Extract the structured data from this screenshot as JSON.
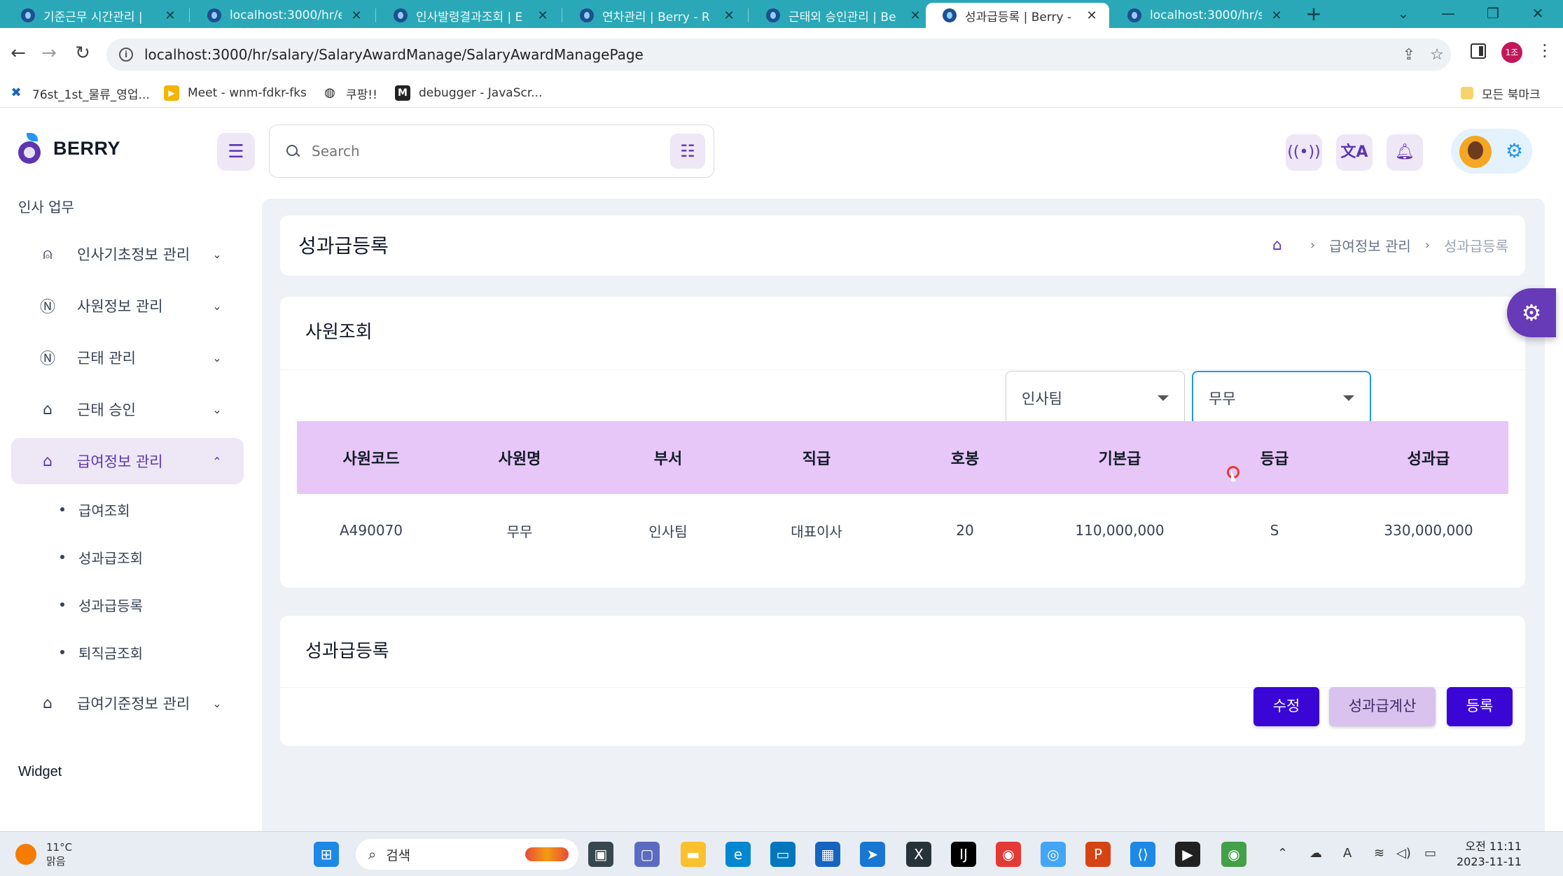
{
  "browser": {
    "tabs": [
      {
        "title": "기준근무 시간관리 |",
        "active": false
      },
      {
        "title": "localhost:3000/hr/en",
        "active": false
      },
      {
        "title": "인사발령결과조회 | E",
        "active": false
      },
      {
        "title": "연차관리 | Berry - R",
        "active": false
      },
      {
        "title": "근태외 승인관리 | Be",
        "active": false
      },
      {
        "title": "성과급등록 | Berry -",
        "active": true
      },
      {
        "title": "localhost:3000/hr/sa",
        "active": false
      }
    ],
    "url": "localhost:3000/hr/salary/SalaryAwardManage/SalaryAwardManagePage",
    "profile_badge": "1조",
    "bookmarks": [
      {
        "label": "76st_1st_물류_영업...",
        "icon": "x-icon",
        "color": "#1565c0"
      },
      {
        "label": "Meet - wnm-fdkr-fks",
        "icon": "meet-icon",
        "color": "#f4b400"
      },
      {
        "label": "쿠팡!!",
        "icon": "globe-icon",
        "color": "#222222"
      },
      {
        "label": "debugger - JavaScr...",
        "icon": "m-icon",
        "color": "#222222"
      }
    ],
    "all_bookmarks": "모든 북마크"
  },
  "app": {
    "logo_text": "BERRY",
    "search": {
      "placeholder": "Search"
    },
    "colors": {
      "primary": "#5e35b1",
      "secondary": "#2196f3",
      "table_header": "#e6c7f7",
      "button_primary": "#3a06d6"
    }
  },
  "sidebar": {
    "heading": "인사 업무",
    "items": [
      {
        "label": "인사기초정보 관리",
        "icon": "user-check-icon",
        "expanded": false
      },
      {
        "label": "사원정보 관리",
        "icon": "notion-icon",
        "expanded": false
      },
      {
        "label": "근태 관리",
        "icon": "notion-icon",
        "expanded": false
      },
      {
        "label": "근태 승인",
        "icon": "basket-icon",
        "expanded": false
      },
      {
        "label": "급여정보 관리",
        "icon": "basket-icon",
        "expanded": true
      },
      {
        "label": "급여기준정보 관리",
        "icon": "basket-icon",
        "expanded": false
      }
    ],
    "sub_items": [
      "급여조회",
      "성과급조회",
      "성과급등록",
      "퇴직금조회"
    ],
    "widget_heading": "Widget"
  },
  "page": {
    "title": "성과급등록",
    "breadcrumb": [
      "급여정보 관리",
      "성과급등록"
    ]
  },
  "employee_search": {
    "title": "사원조회",
    "department_select": "인사팀",
    "employee_select": "무무",
    "table": {
      "columns": [
        "사원코드",
        "사원명",
        "부서",
        "직급",
        "호봉",
        "기본급",
        "등급",
        "성과급"
      ],
      "rows": [
        [
          "A490070",
          "무무",
          "인사팀",
          "대표이사",
          "20",
          "110,000,000",
          "S",
          "330,000,000"
        ]
      ]
    }
  },
  "registration": {
    "title": "성과급등록",
    "buttons": {
      "edit": "수정",
      "calculate": "성과급계산",
      "register": "등록"
    }
  },
  "taskbar": {
    "weather_temp": "11°C",
    "weather_desc": "맑음",
    "search_placeholder": "검색",
    "time": "오전 11:11",
    "date": "2023-11-11"
  }
}
